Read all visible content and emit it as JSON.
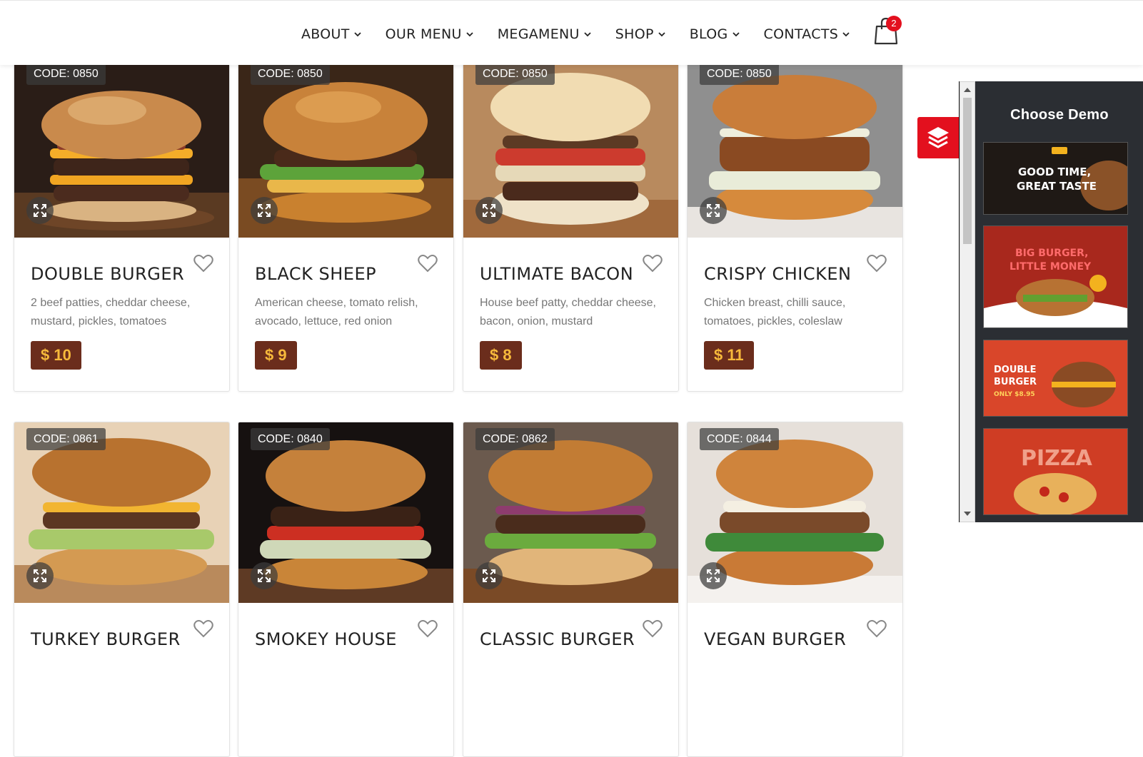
{
  "nav": {
    "items": [
      {
        "label": "ABOUT"
      },
      {
        "label": "OUR MENU"
      },
      {
        "label": "MEGAMENU"
      },
      {
        "label": "SHOP"
      },
      {
        "label": "BLOG"
      },
      {
        "label": "CONTACTS"
      }
    ],
    "cart_count": "2"
  },
  "products": [
    {
      "code": "CODE: 0850",
      "name": "DOUBLE BURGER",
      "desc": "2 beef patties, cheddar cheese, mustard, pickles, tomatoes",
      "price": "$ 10"
    },
    {
      "code": "CODE: 0850",
      "name": "BLACK SHEEP",
      "desc": "American cheese, tomato relish, avocado, lettuce, red onion",
      "price": "$ 9"
    },
    {
      "code": "CODE: 0850",
      "name": "ULTIMATE BACON",
      "desc": "House beef patty, cheddar cheese, bacon, onion, mustard",
      "price": "$ 8"
    },
    {
      "code": "CODE: 0850",
      "name": "CRISPY CHICKEN",
      "desc": "Chicken breast, chilli sauce, tomatoes, pickles, coleslaw",
      "price": "$ 11"
    },
    {
      "code": "CODE: 0861",
      "name": "TURKEY BURGER"
    },
    {
      "code": "CODE: 0840",
      "name": "SMOKEY HOUSE"
    },
    {
      "code": "CODE: 0862",
      "name": "CLASSIC BURGER"
    },
    {
      "code": "CODE: 0844",
      "name": "VEGAN BURGER"
    }
  ],
  "demo_panel": {
    "title": "Choose Demo",
    "demos": [
      {
        "line1": "GOOD TIME,",
        "line2": "GREAT TASTE"
      },
      {
        "line1": "BIG BURGER,",
        "line2": "LITTLE MONEY"
      },
      {
        "line1": "DOUBLE",
        "line2": "BURGER",
        "line3": "ONLY $8.95"
      },
      {
        "line1": "PIZZA"
      }
    ]
  },
  "colors": {
    "accent": "#e3101e",
    "price_bg": "#6b2d1c",
    "price_text": "#f6b93b",
    "panel_bg": "#2b2e33"
  },
  "icons": [
    "chevron-down-icon",
    "shopping-bag-icon",
    "expand-icon",
    "heart-icon",
    "layers-icon"
  ]
}
